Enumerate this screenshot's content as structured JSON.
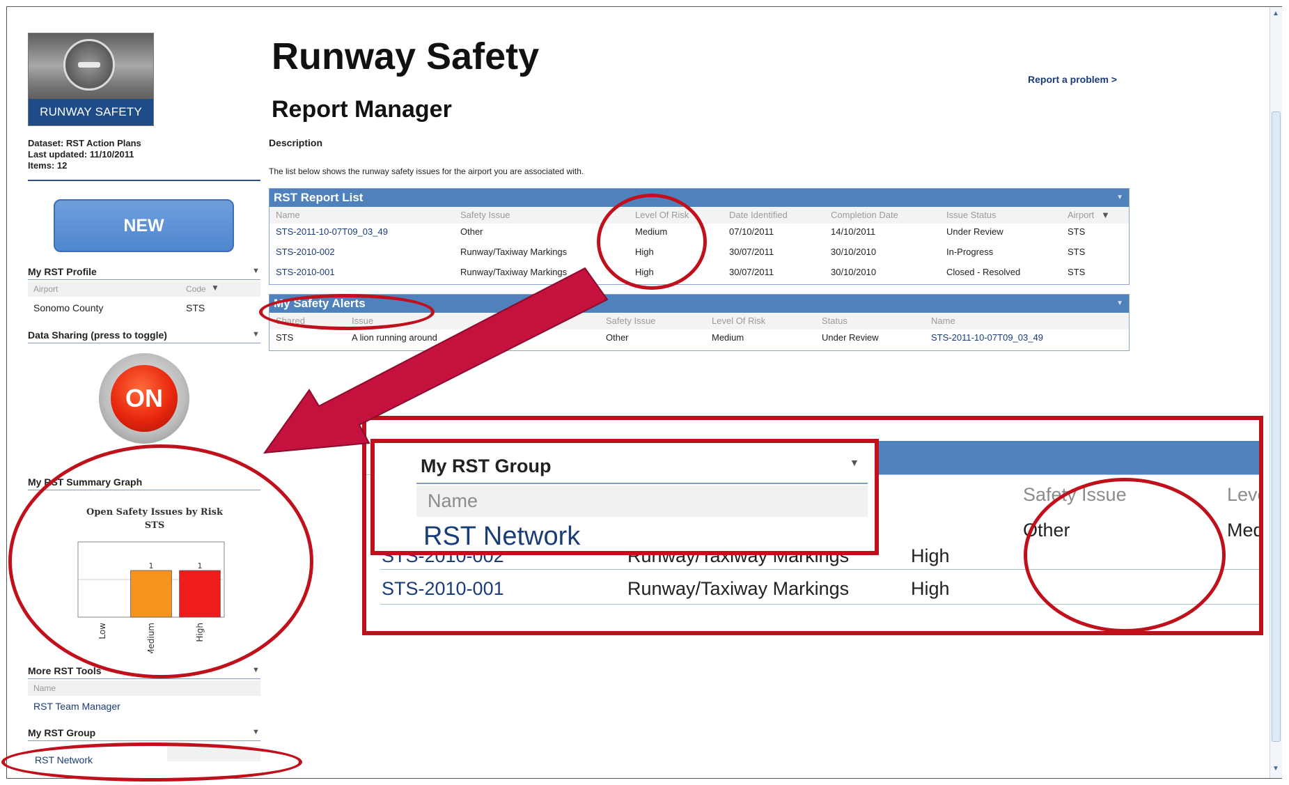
{
  "logo": {
    "caption": "RUNWAY SAFETY"
  },
  "meta": {
    "dataset": "Dataset: RST Action Plans",
    "last_updated": "Last updated: 11/10/2011",
    "items": "Items: 12"
  },
  "new_button": "NEW",
  "profile": {
    "title": "My RST Profile",
    "col_airport": "Airport",
    "col_code": "Code",
    "airport": "Sonomo County",
    "code": "STS"
  },
  "data_sharing": {
    "title": "Data Sharing (press to toggle)",
    "state": "ON"
  },
  "summary_graph": {
    "title": "My RST Summary Graph",
    "chart_title": "Open Safety Issues by Risk",
    "chart_subtitle": "STS"
  },
  "chart_data": {
    "type": "bar",
    "title": "Open Safety Issues by Risk",
    "subtitle": "STS",
    "categories": [
      "Low",
      "Medium",
      "High"
    ],
    "values": [
      0,
      1,
      1
    ],
    "colors": [
      "#a0a0a0",
      "#f7941d",
      "#ee1c1c"
    ],
    "ylim": [
      0,
      1
    ],
    "data_labels": [
      "",
      "1",
      "1"
    ]
  },
  "more_tools": {
    "title": "More RST Tools",
    "col_name": "Name",
    "link": "RST Team Manager"
  },
  "rst_group": {
    "title": "My RST Group",
    "link": "RST Network"
  },
  "header": {
    "title": "Runway Safety",
    "subtitle": "Report Manager",
    "report_link": "Report a problem >",
    "desc_label": "Description",
    "desc_text": "The list below shows the runway safety issues for the airport you are associated with."
  },
  "report_list": {
    "title": "RST Report List",
    "columns": [
      "Name",
      "Safety Issue",
      "Level Of Risk",
      "Date Identified",
      "Completion Date",
      "Issue Status",
      "Airport"
    ],
    "rows": [
      [
        "STS-2011-10-07T09_03_49",
        "Other",
        "Medium",
        "07/10/2011",
        "14/10/2011",
        "Under Review",
        "STS"
      ],
      [
        "STS-2010-002",
        "Runway/Taxiway Markings",
        "High",
        "30/07/2011",
        "30/10/2010",
        "In-Progress",
        "STS"
      ],
      [
        "STS-2010-001",
        "Runway/Taxiway Markings",
        "High",
        "30/07/2011",
        "30/10/2010",
        "Closed - Resolved",
        "STS"
      ]
    ]
  },
  "safety_alerts": {
    "title": "My Safety Alerts",
    "columns": [
      "Shared",
      "Issue",
      "Safety Issue",
      "Level Of Risk",
      "Status",
      "Name"
    ],
    "rows": [
      [
        "STS",
        "A lion running around",
        "Other",
        "Medium",
        "Under Review",
        "STS-2011-10-07T09_03_49"
      ]
    ]
  },
  "zoom": {
    "group_title": "My RST Group",
    "group_col": "Name",
    "group_link": "RST Network",
    "col_safety_issue": "Safety Issue",
    "col_level": "Leve",
    "row1_issue": "Other",
    "row1_level": "Med",
    "row2_name": "STS-2010-002",
    "row2_issue": "Runway/Taxiway Markings",
    "row2_level": "High",
    "row3_name": "STS-2010-001",
    "row3_issue": "Runway/Taxiway Markings",
    "row3_level": "High"
  },
  "colors": {
    "accent_blue": "#4f81bd",
    "annotation_red": "#c0101b",
    "link_blue": "#1a3c78"
  }
}
